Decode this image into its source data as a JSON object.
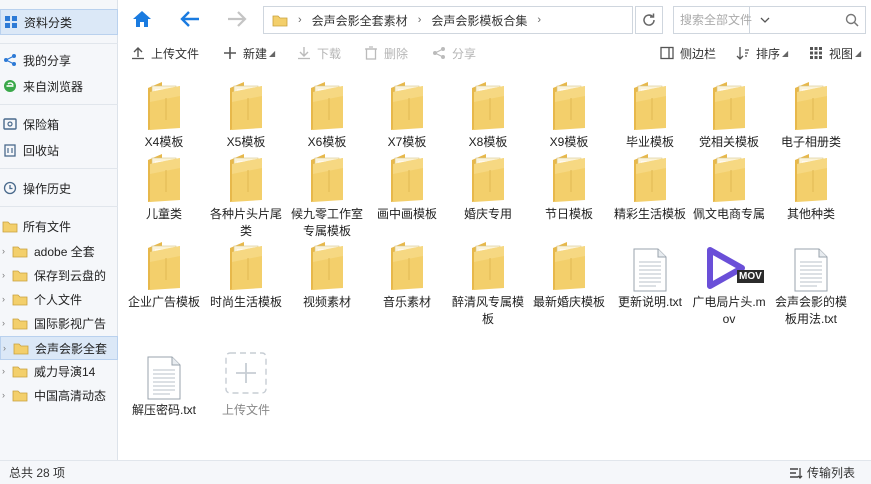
{
  "sidebar": {
    "top": [
      {
        "label": "资料分类",
        "icon": "category-icon"
      },
      {
        "label": "我的分享",
        "icon": "share-icon"
      },
      {
        "label": "来自浏览器",
        "icon": "browser-icon"
      },
      {
        "label": "保险箱",
        "icon": "safe-icon"
      },
      {
        "label": "回收站",
        "icon": "trash-icon"
      },
      {
        "label": "操作历史",
        "icon": "history-icon"
      },
      {
        "label": "所有文件",
        "icon": "folder-icon"
      }
    ],
    "tree": [
      {
        "label": "adobe 全套"
      },
      {
        "label": "保存到云盘的"
      },
      {
        "label": "个人文件"
      },
      {
        "label": "国际影视广告"
      },
      {
        "label": "会声会影全套"
      },
      {
        "label": "威力导演14"
      },
      {
        "label": "中国高清动态"
      }
    ]
  },
  "breadcrumb": [
    "会声会影全套素材",
    "会声会影模板合集"
  ],
  "search": {
    "placeholder": "搜索全部文件"
  },
  "toolbar": {
    "upload": "上传文件",
    "new": "新建",
    "download": "下载",
    "delete": "删除",
    "share": "分享",
    "sidebar": "侧边栏",
    "sort": "排序",
    "view": "视图"
  },
  "items": [
    {
      "name": "X4模板",
      "type": "folder"
    },
    {
      "name": "X5模板",
      "type": "folder"
    },
    {
      "name": "X6模板",
      "type": "folder"
    },
    {
      "name": "X7模板",
      "type": "folder"
    },
    {
      "name": "X8模板",
      "type": "folder"
    },
    {
      "name": "X9模板",
      "type": "folder"
    },
    {
      "name": "毕业模板",
      "type": "folder"
    },
    {
      "name": "党相关模板",
      "type": "folder"
    },
    {
      "name": "电子相册类",
      "type": "folder"
    },
    {
      "name": "儿童类",
      "type": "folder"
    },
    {
      "name": "各种片头片尾类",
      "type": "folder"
    },
    {
      "name": "候九零工作室专属模板",
      "type": "folder"
    },
    {
      "name": "画中画模板",
      "type": "folder"
    },
    {
      "name": "婚庆专用",
      "type": "folder"
    },
    {
      "name": "节日模板",
      "type": "folder"
    },
    {
      "name": "精彩生活模板",
      "type": "folder"
    },
    {
      "name": "佩文电商专属",
      "type": "folder"
    },
    {
      "name": "其他种类",
      "type": "folder"
    },
    {
      "name": "企业广告模板",
      "type": "folder"
    },
    {
      "name": "时尚生活模板",
      "type": "folder"
    },
    {
      "name": "视频素材",
      "type": "folder"
    },
    {
      "name": "音乐素材",
      "type": "folder"
    },
    {
      "name": "醉清风专属模板",
      "type": "folder"
    },
    {
      "name": "最新婚庆模板",
      "type": "folder"
    },
    {
      "name": "更新说明.txt",
      "type": "txt"
    },
    {
      "name": "广电局片头.mov",
      "type": "mov",
      "badge": "MOV"
    },
    {
      "name": "会声会影的模板用法.txt",
      "type": "txt"
    },
    {
      "name": "解压密码.txt",
      "type": "txt"
    },
    {
      "name": "上传文件",
      "type": "upload"
    }
  ],
  "status": {
    "count": "总共 28 项",
    "transfer": "传输列表"
  },
  "colors": {
    "accent": "#1a7be0",
    "folder": "#f3cf6b",
    "mov": "#6a4fd8",
    "active_bg": "#dbe8f7"
  }
}
